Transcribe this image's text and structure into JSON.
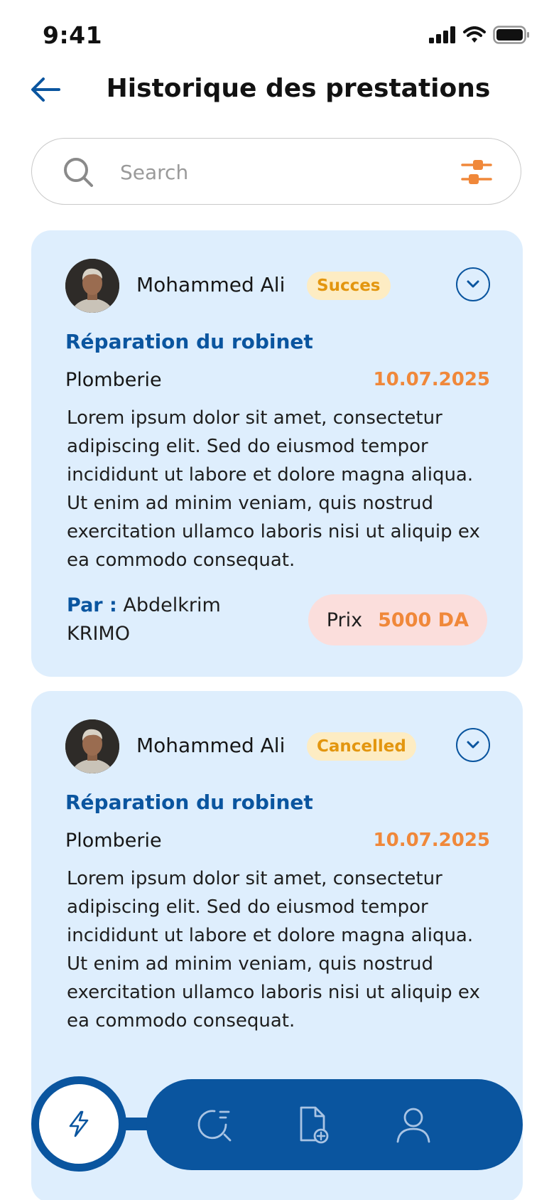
{
  "status_bar": {
    "time": "9:41"
  },
  "header": {
    "title": "Historique des prestations"
  },
  "search": {
    "placeholder": "Search",
    "value": ""
  },
  "history": [
    {
      "provider_name": "Mohammed Ali",
      "status": "Succes",
      "service_title": "Réparation du robinet",
      "category": "Plomberie",
      "date": "10.07.2025",
      "description": "Lorem ipsum dolor sit amet, consectetur adipiscing elit. Sed do eiusmod tempor incididunt ut labore et dolore magna aliqua. Ut enim ad minim veniam, quis nostrud exercitation ullamco laboris nisi ut aliquip ex ea commodo consequat.",
      "by_label": "Par :",
      "by_name": "Abdelkrim KRIMO",
      "price_label": "Prix",
      "price_value": "5000 DA"
    },
    {
      "provider_name": "Mohammed Ali",
      "status": "Cancelled",
      "service_title": "Réparation du robinet",
      "category": "Plomberie",
      "date": "10.07.2025",
      "description": "Lorem ipsum dolor sit amet, consectetur adipiscing elit. Sed do eiusmod tempor incididunt ut labore et dolore magna aliqua. Ut enim ad minim veniam, quis nostrud exercitation ullamco laboris nisi ut aliquip ex ea commodo consequat."
    }
  ],
  "bottom_nav": {
    "active": "lightning-icon",
    "items": [
      "lightning-icon",
      "search-history-icon",
      "add-document-icon",
      "user-icon"
    ]
  },
  "colors": {
    "primary": "#0a559f",
    "accent": "#f0883a",
    "card_background": "#deeefd",
    "status_badge_background": "#fdecc3",
    "status_badge_text": "#e3960f",
    "price_pill_background": "#fbdedc"
  }
}
